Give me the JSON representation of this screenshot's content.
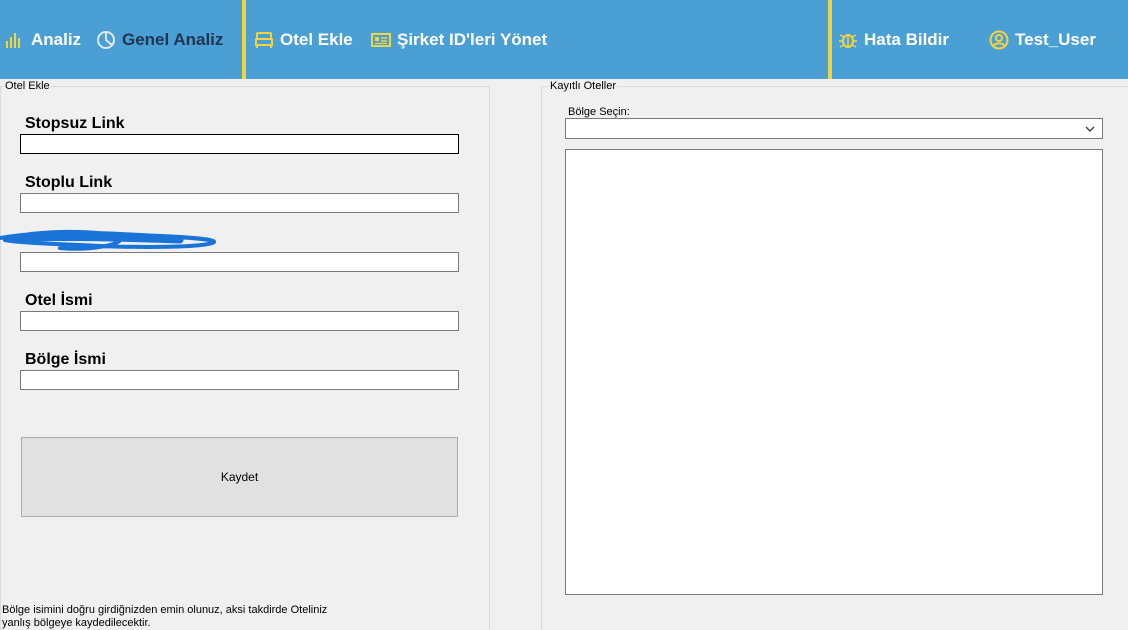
{
  "nav": {
    "analiz": "Analiz",
    "genel_analiz": "Genel Analiz",
    "otel_ekle": "Otel Ekle",
    "sirket_id": "Şirket ID'leri Yönet",
    "hata_bildir": "Hata Bildir",
    "user": "Test_User"
  },
  "icons": {
    "analiz": "bar-chart-icon",
    "genel_analiz": "pie-chart-icon",
    "otel_ekle": "bed-icon",
    "sirket_id": "id-card-icon",
    "hata_bildir": "bug-icon",
    "user": "user-circle-icon"
  },
  "colors": {
    "nav_bg": "#4a9fd5",
    "nav_divider": "#f5d33f",
    "icon": "#f5d33f",
    "active_text": "#1f3550"
  },
  "otel_ekle": {
    "group_title": "Otel Ekle",
    "fields": [
      {
        "label": "Stopsuz Link",
        "value": ""
      },
      {
        "label": "Stoplu Link",
        "value": ""
      },
      {
        "label": "",
        "value": ""
      },
      {
        "label": "Otel İsmi",
        "value": ""
      },
      {
        "label": "Bölge İsmi",
        "value": ""
      }
    ],
    "save_label": "Kaydet",
    "note": "Bölge isimini doğru girdiğnizden emin olunuz, aksi takdirde Oteliniz yanlış bölgeye kaydedilecektir."
  },
  "kayitli": {
    "group_title": "Kayıtlı Oteller",
    "select_label": "Bölge Seçin:",
    "select_value": "",
    "items": []
  }
}
